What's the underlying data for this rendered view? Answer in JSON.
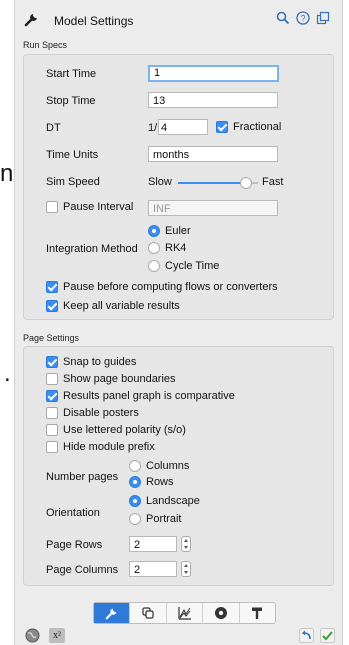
{
  "window": {
    "title": "Model Settings"
  },
  "titlebar_icons": [
    "search-icon",
    "help-icon",
    "detach-icon"
  ],
  "run_specs": {
    "section_title": "Run Specs",
    "start_time": {
      "label": "Start Time",
      "value": "1"
    },
    "stop_time": {
      "label": "Stop Time",
      "value": "13"
    },
    "dt": {
      "label": "DT",
      "prefix": "1/",
      "value": "4",
      "fractional_label": "Fractional",
      "fractional_checked": true
    },
    "time_units": {
      "label": "Time Units",
      "value": "months"
    },
    "sim_speed": {
      "label": "Sim Speed",
      "min_label": "Slow",
      "max_label": "Fast",
      "level": 0.85
    },
    "pause_interval": {
      "label": "Pause Interval",
      "checked": false,
      "value": "INF"
    },
    "integration": {
      "label": "Integration Method",
      "options": [
        "Euler",
        "RK4",
        "Cycle Time"
      ],
      "selected": "Euler"
    },
    "pause_before": {
      "label": "Pause before computing flows or converters",
      "checked": true
    },
    "keep_all": {
      "label": "Keep all variable results",
      "checked": true
    }
  },
  "page_settings": {
    "section_title": "Page Settings",
    "snap": {
      "label": "Snap to guides",
      "checked": true
    },
    "show_boundaries": {
      "label": "Show page boundaries",
      "checked": false
    },
    "results_comparative": {
      "label": "Results panel graph is comparative",
      "checked": true
    },
    "disable_posters": {
      "label": "Disable posters",
      "checked": false
    },
    "lettered_polarity": {
      "label": "Use lettered polarity (s/o)",
      "checked": false
    },
    "hide_module_prefix": {
      "label": "Hide module prefix",
      "checked": false
    },
    "number_pages": {
      "label": "Number pages",
      "options": [
        "Columns",
        "Rows"
      ],
      "selected": "Rows"
    },
    "orientation": {
      "label": "Orientation",
      "options": [
        "Landscape",
        "Portrait"
      ],
      "selected": "Landscape"
    },
    "page_rows": {
      "label": "Page Rows",
      "value": "2"
    },
    "page_columns": {
      "label": "Page Columns",
      "value": "2"
    }
  },
  "tabs": [
    "wrench-icon",
    "layers-icon",
    "chart-icon",
    "gauge-icon",
    "paint-roller-icon"
  ],
  "background_text": {
    "char1": "n",
    "char2": "."
  },
  "bottom_bar": {
    "left_icons": [
      "globe-icon",
      "superscript-icon"
    ],
    "superscript": "x²",
    "right_icons": [
      "undo-icon",
      "apply-check-icon"
    ]
  },
  "colors": {
    "accent": "#3a8df2",
    "panel_bg": "#ececec",
    "box_bg": "#e6e6e6"
  }
}
